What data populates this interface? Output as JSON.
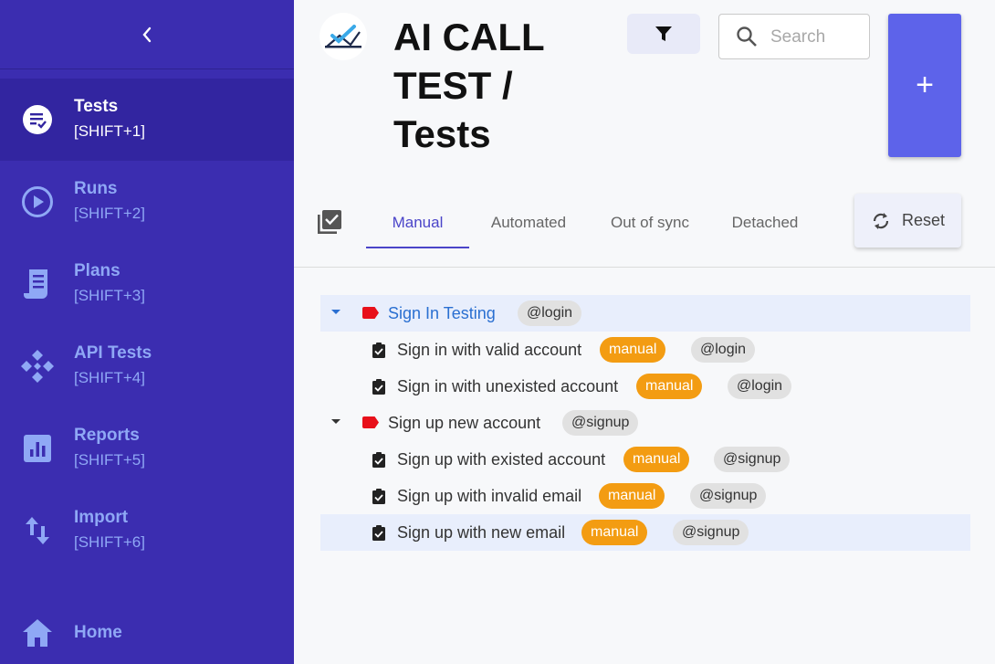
{
  "sidebar": {
    "items": [
      {
        "label": "Tests",
        "shortcut": "[SHIFT+1]",
        "icon": "tests-icon"
      },
      {
        "label": "Runs",
        "shortcut": "[SHIFT+2]",
        "icon": "play-circle-icon"
      },
      {
        "label": "Plans",
        "shortcut": "[SHIFT+3]",
        "icon": "plans-icon"
      },
      {
        "label": "API Tests",
        "shortcut": "[SHIFT+4]",
        "icon": "api-icon"
      },
      {
        "label": "Reports",
        "shortcut": "[SHIFT+5]",
        "icon": "reports-icon"
      },
      {
        "label": "Import",
        "shortcut": "[SHIFT+6]",
        "icon": "import-icon"
      }
    ],
    "home_label": "Home"
  },
  "header": {
    "title_line1": "AI CALL",
    "title_line2": "TEST /",
    "title_line3": "Tests",
    "search_placeholder": "Search",
    "add_label": "+"
  },
  "tabs": {
    "items": [
      "Manual",
      "Automated",
      "Out of sync",
      "Detached"
    ],
    "active": "Manual",
    "reset_label": "Reset"
  },
  "tree": {
    "suites": [
      {
        "name": "Sign In Testing",
        "tag": "@login",
        "tests": [
          {
            "name": "Sign in with valid account",
            "type": "manual",
            "tag": "@login"
          },
          {
            "name": "Sign in with unexisted account",
            "type": "manual",
            "tag": "@login"
          }
        ]
      },
      {
        "name": "Sign up new account",
        "tag": "@signup",
        "tests": [
          {
            "name": "Sign up with existed account",
            "type": "manual",
            "tag": "@signup"
          },
          {
            "name": "Sign up with invalid email",
            "type": "manual",
            "tag": "@signup"
          },
          {
            "name": "Sign up with new email",
            "type": "manual",
            "tag": "@signup"
          }
        ]
      }
    ]
  },
  "colors": {
    "sidebar_bg": "#3b2db0",
    "accent": "#5d63ea",
    "manual_badge": "#f39c12",
    "suite_tag": "#e8101a"
  }
}
